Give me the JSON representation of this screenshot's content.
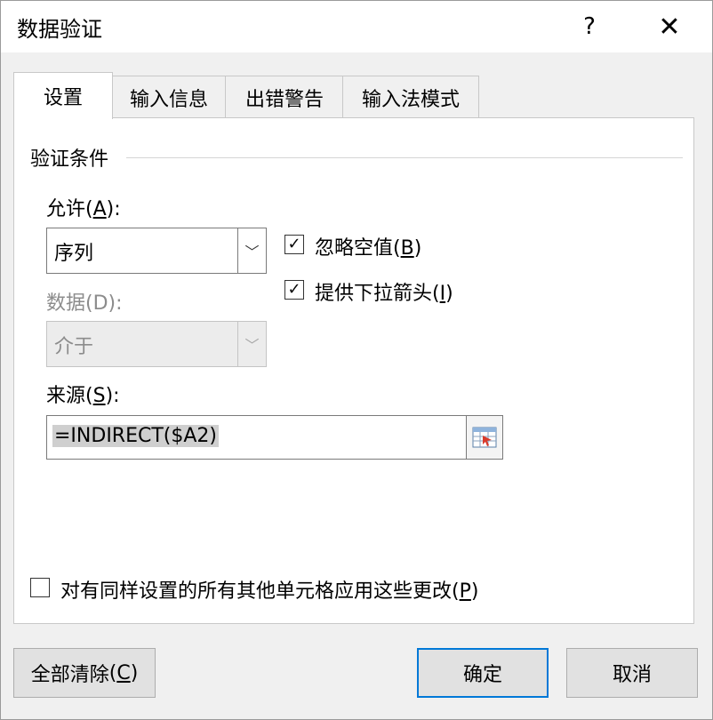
{
  "dialog": {
    "title": "数据验证",
    "help_label": "?",
    "close_label": "✕"
  },
  "tabs": [
    {
      "label": "设置",
      "active": true
    },
    {
      "label": "输入信息",
      "active": false
    },
    {
      "label": "出错警告",
      "active": false
    },
    {
      "label": "输入法模式",
      "active": false
    }
  ],
  "settings": {
    "group_title": "验证条件",
    "allow": {
      "label": "允许",
      "key": "A",
      "suffix": "):",
      "value": "序列"
    },
    "data": {
      "label": "数据(D):",
      "value": "介于",
      "disabled": true
    },
    "source": {
      "label": "来源",
      "key": "S",
      "suffix": "):",
      "value": "=INDIRECT($A2)"
    },
    "ignore_blank": {
      "label": "忽略空值",
      "key": "B",
      "checked": true
    },
    "dropdown": {
      "label": "提供下拉箭头",
      "key": "I",
      "checked": true
    },
    "apply_all": {
      "label": "对有同样设置的所有其他单元格应用这些更改",
      "key": "P",
      "checked": false
    }
  },
  "buttons": {
    "clear_all": {
      "label": "全部清除",
      "key": "C"
    },
    "ok": "确定",
    "cancel": "取消"
  },
  "icons": {
    "check_mark": "✓",
    "dropdown_arrow": "﹀",
    "range_selector": "range-select-icon"
  },
  "colors": {
    "accent": "#0078d7",
    "window_bg": "#f0f0f0",
    "panel_bg": "#ffffff"
  }
}
